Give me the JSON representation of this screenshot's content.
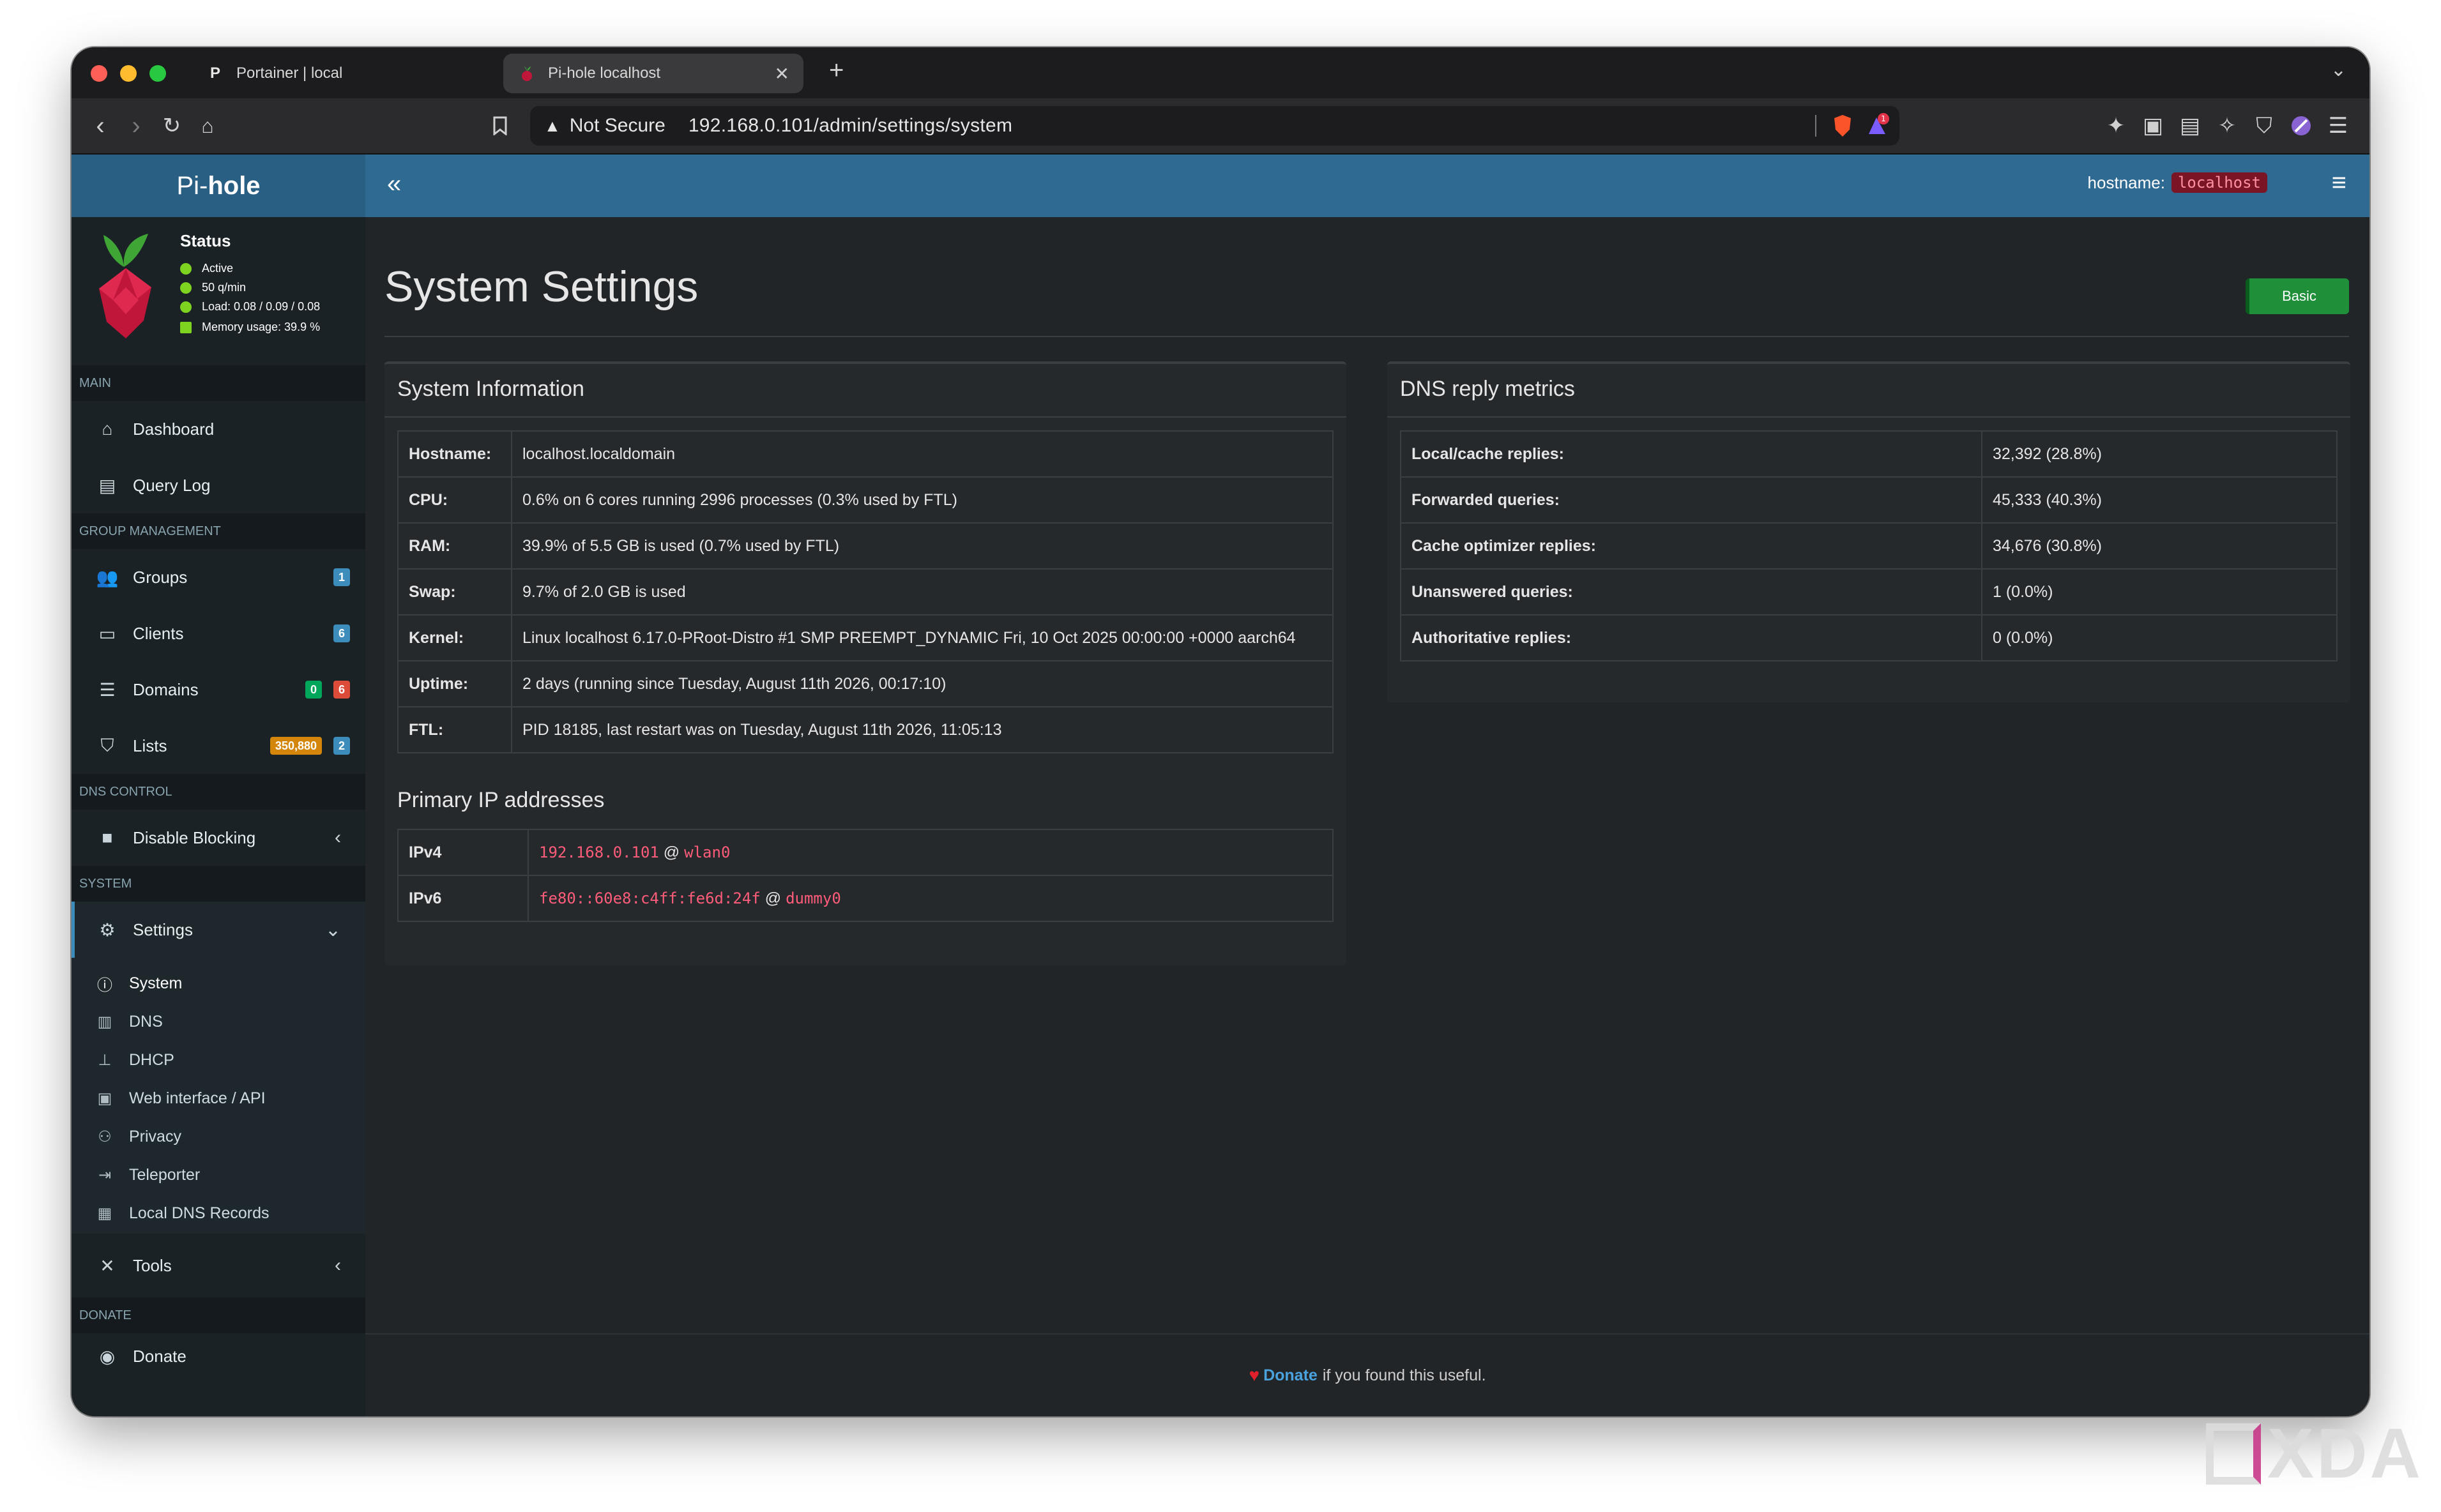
{
  "browser": {
    "tabs": [
      {
        "label": "Portainer | local",
        "icon": "portainer-icon",
        "active": false
      },
      {
        "label": "Pi-hole localhost",
        "icon": "pihole-icon",
        "active": true
      }
    ],
    "address": {
      "security_label": "Not Secure",
      "url": "192.168.0.101/admin/settings/system"
    },
    "shield_badge": "1"
  },
  "app": {
    "logo_prefix": "Pi-",
    "logo_bold": "hole",
    "hostname_label": "hostname:",
    "hostname_value": "localhost",
    "status": {
      "title": "Status",
      "active": "Active",
      "rate": "50 q/min",
      "load": "Load: 0.08 / 0.09 / 0.08",
      "memory": "Memory usage: 39.9 %"
    },
    "sidebar": {
      "main_header": "MAIN",
      "dashboard": "Dashboard",
      "query_log": "Query Log",
      "group_header": "GROUP MANAGEMENT",
      "groups": "Groups",
      "groups_count": "1",
      "clients": "Clients",
      "clients_count": "6",
      "domains": "Domains",
      "domains_allow": "0",
      "domains_deny": "6",
      "lists": "Lists",
      "lists_domains": "350,880",
      "lists_count": "2",
      "dns_header": "DNS CONTROL",
      "disable_blocking": "Disable Blocking",
      "system_header": "SYSTEM",
      "settings": "Settings",
      "sub": {
        "system": "System",
        "dns": "DNS",
        "dhcp": "DHCP",
        "web": "Web interface / API",
        "privacy": "Privacy",
        "teleporter": "Teleporter",
        "local_dns": "Local DNS Records"
      },
      "tools": "Tools",
      "donate_header": "DONATE",
      "donate": "Donate"
    },
    "page_title": "System Settings",
    "mode_button": "Basic",
    "system_info": {
      "title": "System Information",
      "rows": [
        {
          "k": "Hostname:",
          "v": "localhost.localdomain"
        },
        {
          "k": "CPU:",
          "v": "0.6% on 6 cores running 2996 processes (0.3% used by FTL)"
        },
        {
          "k": "RAM:",
          "v": "39.9% of 5.5 GB is used (0.7% used by FTL)"
        },
        {
          "k": "Swap:",
          "v": "9.7% of 2.0 GB is used"
        },
        {
          "k": "Kernel:",
          "v": "Linux localhost 6.17.0-PRoot-Distro #1 SMP PREEMPT_DYNAMIC Fri, 10 Oct 2025 00:00:00 +0000 aarch64"
        },
        {
          "k": "Uptime:",
          "v": "2 days (running since Tuesday, August 11th 2026, 00:17:10)"
        },
        {
          "k": "FTL:",
          "v": "PID 18185, last restart was on Tuesday, August 11th 2026, 11:05:13"
        }
      ]
    },
    "ip_section": {
      "title": "Primary IP addresses",
      "rows": [
        {
          "k": "IPv4",
          "addr": "192.168.0.101",
          "at": "@",
          "iface": "wlan0"
        },
        {
          "k": "IPv6",
          "addr": "fe80::60e8:c4ff:fe6d:24f",
          "at": "@",
          "iface": "dummy0"
        }
      ]
    },
    "dns_metrics": {
      "title": "DNS reply metrics",
      "rows": [
        {
          "k": "Local/cache replies:",
          "v": "32,392 (28.8%)"
        },
        {
          "k": "Forwarded queries:",
          "v": "45,333 (40.3%)"
        },
        {
          "k": "Cache optimizer replies:",
          "v": "34,676 (30.8%)"
        },
        {
          "k": "Unanswered queries:",
          "v": "1 (0.0%)"
        },
        {
          "k": "Authoritative replies:",
          "v": "0 (0.0%)"
        }
      ]
    },
    "footer": {
      "donate": "Donate",
      "text": "if you found this useful."
    }
  },
  "watermark": "XDA",
  "colors": {
    "topbar": "#2f6a92",
    "sidebar": "#1a2226",
    "content": "#212528",
    "basic_button": "#1f8f3a",
    "ip_text": "#ff5c7a",
    "badge_blue": "#3c8dbc",
    "badge_green": "#00a65a",
    "badge_red": "#dd4b39",
    "badge_orange": "#d4860b"
  }
}
